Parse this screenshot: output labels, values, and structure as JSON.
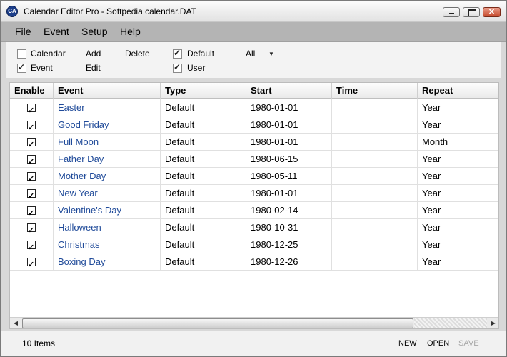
{
  "window": {
    "title": "Calendar Editor Pro - Softpedia calendar.DAT",
    "icon_label": "CA",
    "minimize_icon": "minimize-icon",
    "maximize_icon": "maximize-icon",
    "close_glyph": "✕"
  },
  "menu": {
    "file": "File",
    "event": "Event",
    "setup": "Setup",
    "help": "Help"
  },
  "toolbar": {
    "calendar_label": "Calendar",
    "calendar_checked": false,
    "event_label": "Event",
    "event_checked": true,
    "add": "Add",
    "edit": "Edit",
    "delete": "Delete",
    "default_label": "Default",
    "default_checked": true,
    "user_label": "User",
    "user_checked": true,
    "filter_value": "All"
  },
  "table": {
    "headers": {
      "enable": "Enable",
      "event": "Event",
      "type": "Type",
      "start": "Start",
      "time": "Time",
      "repeat": "Repeat"
    },
    "rows": [
      {
        "enabled": true,
        "event": "Easter",
        "type": "Default",
        "start": "1980-01-01",
        "time": "",
        "repeat": "Year"
      },
      {
        "enabled": true,
        "event": "Good Friday",
        "type": "Default",
        "start": "1980-01-01",
        "time": "",
        "repeat": "Year"
      },
      {
        "enabled": true,
        "event": "Full Moon",
        "type": "Default",
        "start": "1980-01-01",
        "time": "",
        "repeat": "Month"
      },
      {
        "enabled": true,
        "event": "Father Day",
        "type": "Default",
        "start": "1980-06-15",
        "time": "",
        "repeat": "Year"
      },
      {
        "enabled": true,
        "event": "Mother Day",
        "type": "Default",
        "start": "1980-05-11",
        "time": "",
        "repeat": "Year"
      },
      {
        "enabled": true,
        "event": "New Year",
        "type": "Default",
        "start": "1980-01-01",
        "time": "",
        "repeat": "Year"
      },
      {
        "enabled": true,
        "event": "Valentine's Day",
        "type": "Default",
        "start": "1980-02-14",
        "time": "",
        "repeat": "Year"
      },
      {
        "enabled": true,
        "event": "Halloween",
        "type": "Default",
        "start": "1980-10-31",
        "time": "",
        "repeat": "Year"
      },
      {
        "enabled": true,
        "event": "Christmas",
        "type": "Default",
        "start": "1980-12-25",
        "time": "",
        "repeat": "Year"
      },
      {
        "enabled": true,
        "event": "Boxing Day",
        "type": "Default",
        "start": "1980-12-26",
        "time": "",
        "repeat": "Year"
      }
    ]
  },
  "status": {
    "count": "10 Items",
    "new": "NEW",
    "open": "OPEN",
    "save": "SAVE"
  },
  "colors": {
    "event_text": "#1f4a99",
    "menubar": "#b4b4b4",
    "close_button": "#c64a2c"
  }
}
